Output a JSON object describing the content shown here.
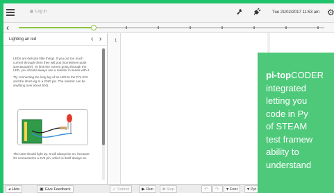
{
  "topbar": {
    "menu_icon": "hamburger-menu-icon",
    "user_label": "Log in",
    "tool_icons": [
      "pin-icon",
      "plug-icon"
    ],
    "datetime": "Tue 21/02/2017 11:53 am",
    "settings_icon": "gear-icon"
  },
  "timeline": {
    "back_icon": "chevron-left-icon",
    "progress_fraction": 0.245
  },
  "lesson": {
    "title": "Lighting an led",
    "prev_symbol": "‹",
    "next_symbol": "›",
    "paragraphs": [
      "LEDs are delicate little things. If you put too much current through them they will pop (sometimes quite spectacularly). To limit the current going through the LED, you should always use a resistor in series with it.",
      "Try connecting the long leg of an LED to the Pi's 3V3 and the short leg to a GND pin. The resistor can be anything over about 50Ω.",
      "The LED should light up. It will always be on, because it's connected to a 3V3 pin, which is itself always on."
    ]
  },
  "editor": {
    "line_numbers": [
      "1"
    ]
  },
  "bottombar": {
    "hide_label": "Hide",
    "feedback_label": "Give Feedback",
    "submit_label": "Submit",
    "run_label": "Run",
    "stop_label": "Stop",
    "font_label": "Font",
    "py_label": "Pyt"
  },
  "promo": {
    "brand": "pi-top",
    "brand_rest": "CODER",
    "lines": [
      "integrated",
      "letting you",
      "code in Py",
      "of STEAM",
      "test framew",
      "ability to",
      "understand"
    ]
  },
  "colors": {
    "brand_green": "#20c26b",
    "promo_green": "#4ec97a",
    "timeline_accent": "#8cc63f"
  }
}
